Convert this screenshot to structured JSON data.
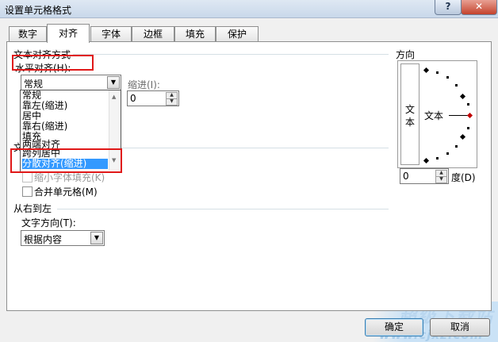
{
  "window": {
    "title": "设置单元格格式",
    "help_label": "?",
    "close_label": "✕"
  },
  "tabs": [
    {
      "label": "数字",
      "active": false
    },
    {
      "label": "对齐",
      "active": true
    },
    {
      "label": "字体",
      "active": false
    },
    {
      "label": "边框",
      "active": false
    },
    {
      "label": "填充",
      "active": false
    },
    {
      "label": "保护",
      "active": false
    }
  ],
  "text_alignment": {
    "section_label": "文本对齐方式",
    "horizontal_label": "水平对齐(H):",
    "horizontal_value": "常规",
    "indent_label": "缩进(I):",
    "indent_value": "0",
    "dropdown_options": [
      "常规",
      "靠左(缩进)",
      "居中",
      "靠右(缩进)",
      "填充",
      "两端对齐",
      "跨列居中",
      "分散对齐(缩进)"
    ],
    "selected_option": "分散对齐(缩进)",
    "partial_section_letter": "文"
  },
  "text_control": {
    "shrink_label": "缩小字体填充(K)",
    "merge_label": "合并单元格(M)"
  },
  "rtl": {
    "section_label": "从右到左",
    "direction_label": "文字方向(T):",
    "direction_value": "根据内容"
  },
  "orientation": {
    "section_label": "方向",
    "vertical_text": [
      "文",
      "本"
    ],
    "sample_text": "文本",
    "degrees_value": "0",
    "degrees_label": "度(D)"
  },
  "buttons": {
    "ok_label": "确定",
    "cancel_label": "取消"
  },
  "watermark": {
    "text": "超级下载站",
    "url": "www.cjxz.com"
  },
  "colors": {
    "highlight": "#e01818",
    "selection": "#3399ff"
  }
}
